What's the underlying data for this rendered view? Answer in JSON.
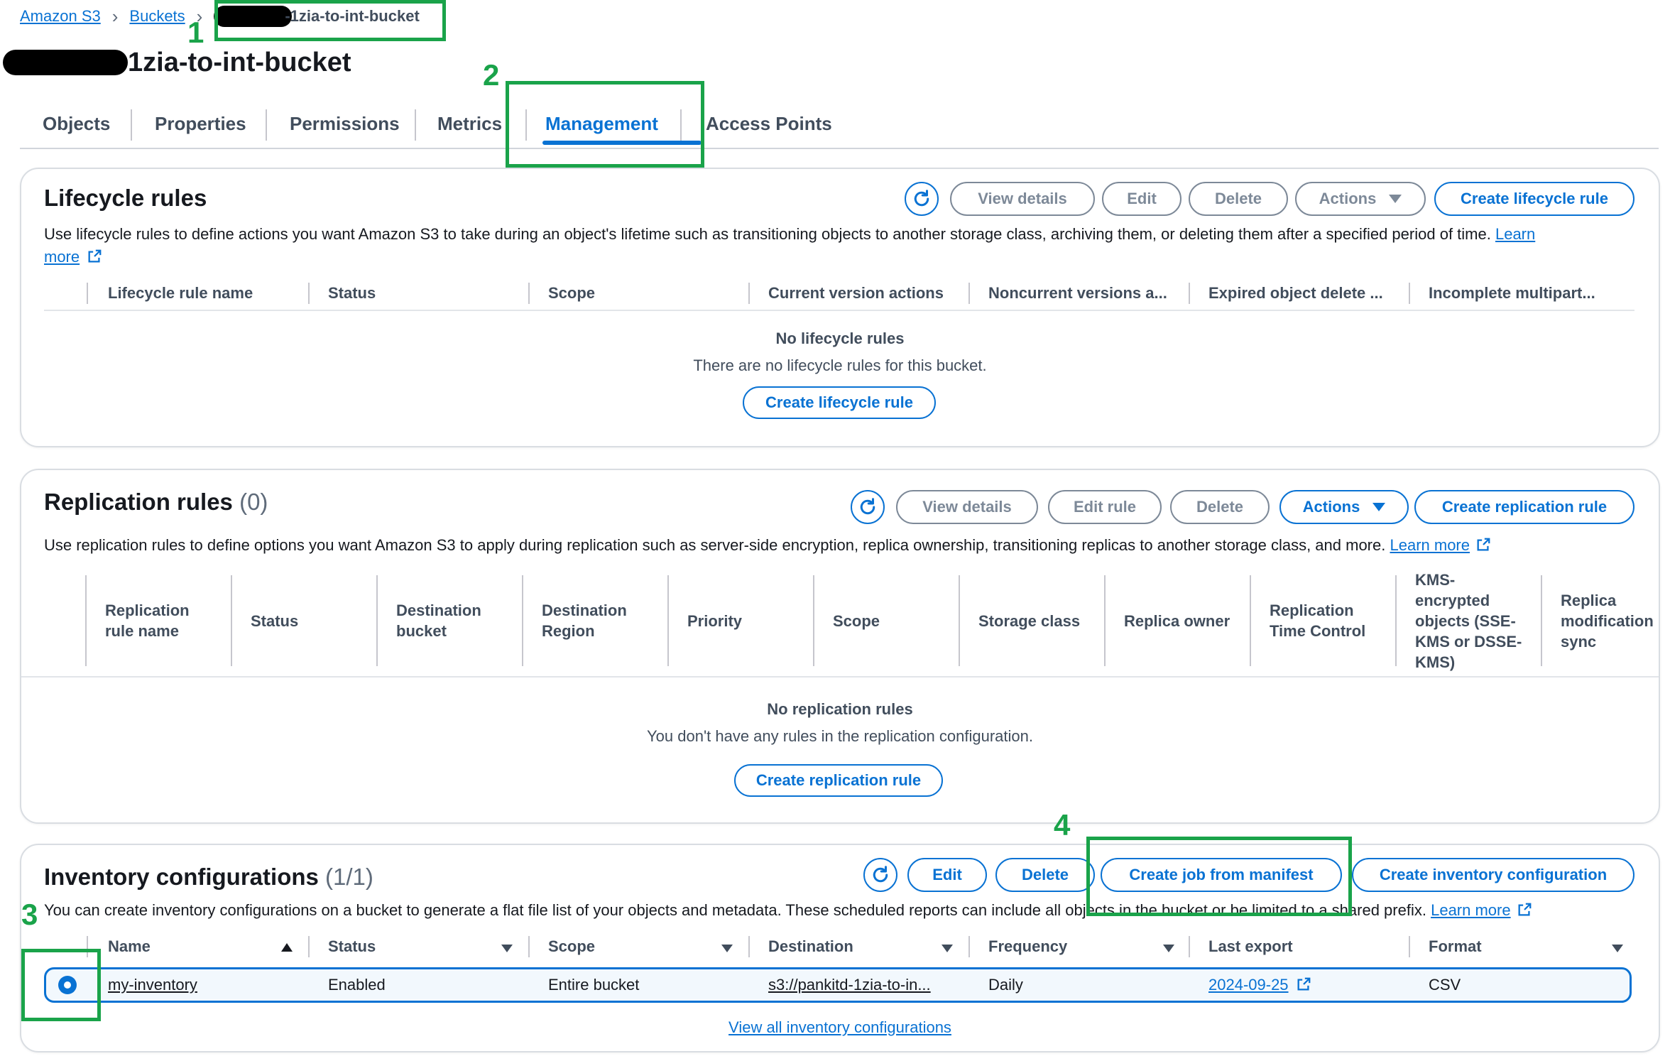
{
  "breadcrumb": {
    "root": "Amazon S3",
    "buckets": "Buckets",
    "current": "-1zia-to-int-bucket"
  },
  "page_title": "1zia-to-int-bucket",
  "tabs": [
    "Objects",
    "Properties",
    "Permissions",
    "Metrics",
    "Management",
    "Access Points"
  ],
  "active_tab": "Management",
  "lifecycle": {
    "title": "Lifecycle rules",
    "buttons": {
      "view_details": "View details",
      "edit": "Edit",
      "delete": "Delete",
      "actions": "Actions",
      "create": "Create lifecycle rule"
    },
    "description": "Use lifecycle rules to define actions you want Amazon S3 to take during an object's lifetime such as transitioning objects to another storage class, archiving them, or deleting them after a specified period of time.",
    "learn_more_1": "Learn",
    "learn_more_2": "more",
    "columns": [
      "Lifecycle rule name",
      "Status",
      "Scope",
      "Current version actions",
      "Noncurrent versions a...",
      "Expired object delete ...",
      "Incomplete multipart..."
    ],
    "empty_title": "No lifecycle rules",
    "empty_sub": "There are no lifecycle rules for this bucket.",
    "empty_button": "Create lifecycle rule"
  },
  "replication": {
    "title": "Replication rules",
    "count": "(0)",
    "buttons": {
      "view_details": "View details",
      "edit_rule": "Edit rule",
      "delete": "Delete",
      "actions": "Actions",
      "create": "Create replication rule"
    },
    "description": "Use replication rules to define options you want Amazon S3 to apply during replication such as server-side encryption, replica ownership, transitioning replicas to another storage class, and more.",
    "learn_more": "Learn more",
    "columns": [
      [
        "Replication",
        "rule name"
      ],
      [
        "Status"
      ],
      [
        "Destination",
        "bucket"
      ],
      [
        "Destination",
        "Region"
      ],
      [
        "Priority"
      ],
      [
        "Scope"
      ],
      [
        "Storage class"
      ],
      [
        "Replica owner"
      ],
      [
        "Replication",
        "Time Control"
      ],
      [
        "KMS-",
        "encrypted",
        "objects (SSE-",
        "KMS or DSSE-",
        "KMS)"
      ],
      [
        "Replica",
        "modification",
        "sync"
      ]
    ],
    "empty_title": "No replication rules",
    "empty_sub": "You don't have any rules in the replication configuration.",
    "empty_button": "Create replication rule"
  },
  "inventory": {
    "title": "Inventory configurations",
    "count": "(1/1)",
    "buttons": {
      "edit": "Edit",
      "delete": "Delete",
      "create_job": "Create job from manifest",
      "create": "Create inventory configuration"
    },
    "description_a": "You can create inventory configurations on a bucket to generate a flat file list of your objects and metadata. These scheduled reports can include",
    "description_hidden": "all objects in the bucket or be limite",
    "description_b": "d to a shared prefix.",
    "learn_more": "Learn more",
    "columns": [
      "Name",
      "Status",
      "Scope",
      "Destination",
      "Frequency",
      "Last export",
      "Format"
    ],
    "rows": [
      {
        "name": "my-inventory",
        "status": "Enabled",
        "scope": "Entire bucket",
        "destination": "s3://pankitd-1zia-to-in...",
        "frequency": "Daily",
        "last_export": "2024-09-25",
        "format": "CSV"
      }
    ],
    "view_all": "View all inventory configurations"
  },
  "annotations": [
    "1",
    "2",
    "3",
    "4"
  ],
  "colors": {
    "link": "#0972d3",
    "annotation": "#1aa34a",
    "text": "#16191f",
    "muted": "#414d5c"
  }
}
